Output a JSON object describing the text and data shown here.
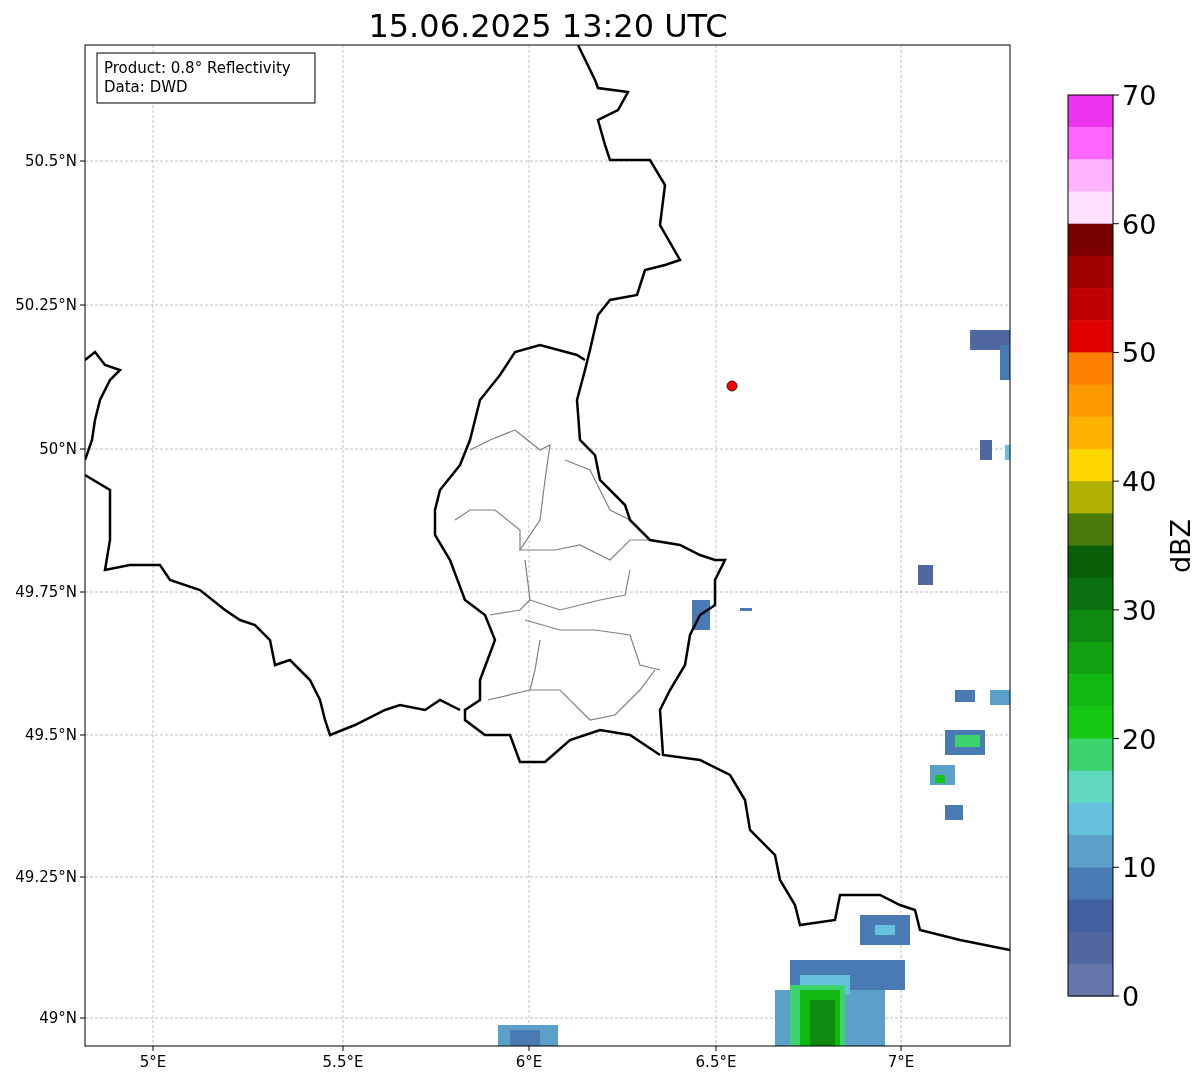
{
  "title": "15.06.2025 13:20 UTC",
  "info_box": [
    "Product: 0.8° Reflectivity",
    "Data: DWD"
  ],
  "map": {
    "lat_ticks": [
      "50.5°N",
      "50.25°N",
      "50°N",
      "49.75°N",
      "49.5°N",
      "49.25°N",
      "49°N"
    ],
    "lon_ticks": [
      "5°E",
      "5.5°E",
      "6°E",
      "6.5°E",
      "7°E"
    ]
  },
  "colorbar": {
    "label": "dBZ",
    "ticks": [
      "70",
      "60",
      "50",
      "40",
      "30",
      "20",
      "10",
      "0"
    ],
    "bins": [
      {
        "color": "#ee33ee"
      },
      {
        "color": "#ff66ff"
      },
      {
        "color": "#ffb3ff"
      },
      {
        "color": "#ffe0ff"
      },
      {
        "color": "#7a0000"
      },
      {
        "color": "#a00000"
      },
      {
        "color": "#c00000"
      },
      {
        "color": "#e00000"
      },
      {
        "color": "#ff7f00"
      },
      {
        "color": "#ff9900"
      },
      {
        "color": "#ffb300"
      },
      {
        "color": "#ffd700"
      },
      {
        "color": "#b0b000"
      },
      {
        "color": "#4a7a0a"
      },
      {
        "color": "#085f08"
      },
      {
        "color": "#0a7010"
      },
      {
        "color": "#0e8a10"
      },
      {
        "color": "#10a010"
      },
      {
        "color": "#12b812"
      },
      {
        "color": "#14c814"
      },
      {
        "color": "#3cd46c"
      },
      {
        "color": "#60d8c0"
      },
      {
        "color": "#66c2dc"
      },
      {
        "color": "#5aa0c8"
      },
      {
        "color": "#4a7ab4"
      },
      {
        "color": "#4260a0"
      },
      {
        "color": "#50689f"
      },
      {
        "color": "#6676aa"
      }
    ]
  }
}
